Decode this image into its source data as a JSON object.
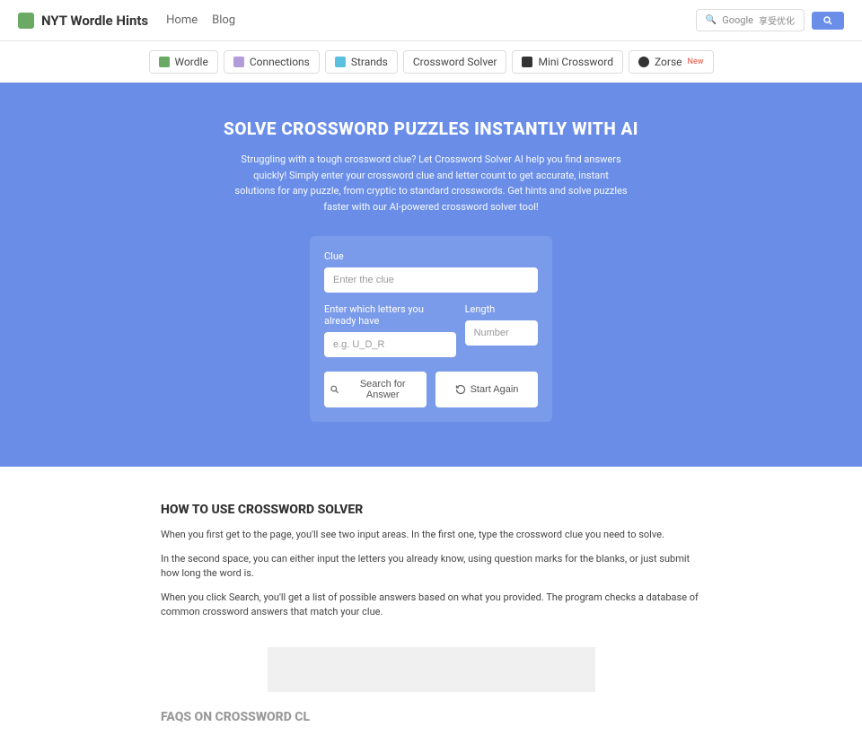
{
  "header": {
    "logo_text": "NYT Wordle Hints",
    "nav": {
      "home": "Home",
      "blog": "Blog"
    },
    "google_label": "Google",
    "google_sub": "享受优化"
  },
  "tabs": [
    {
      "label": "Wordle",
      "icon_color": "#6aaa64"
    },
    {
      "label": "Connections",
      "icon_color": "#b19cd9"
    },
    {
      "label": "Strands",
      "icon_color": "#5bc0de"
    },
    {
      "label": "Crossword Solver",
      "icon_color": ""
    },
    {
      "label": "Mini Crossword",
      "icon_color": "#333"
    },
    {
      "label": "Zorse",
      "icon_color": "#333",
      "new": "New"
    }
  ],
  "hero": {
    "title": "SOLVE CROSSWORD PUZZLES INSTANTLY WITH AI",
    "description": "Struggling with a tough crossword clue? Let Crossword Solver AI help you find answers quickly! Simply enter your crossword clue and letter count to get accurate, instant solutions for any puzzle, from cryptic to standard crosswords. Get hints and solve puzzles faster with our AI-powered crossword solver tool!"
  },
  "form": {
    "clue_label": "Clue",
    "clue_placeholder": "Enter the clue",
    "letters_label": "Enter which letters you already have",
    "letters_placeholder": "e.g. U_D_R",
    "length_label": "Length",
    "length_placeholder": "Number",
    "search_btn": "Search for Answer",
    "reset_btn": "Start Again"
  },
  "howto": {
    "title": "HOW TO USE CROSSWORD SOLVER",
    "p1": "When you first get to the page, you'll see two input areas. In the first one, type the crossword clue you need to solve.",
    "p2": "In the second space, you can either input the letters you already know, using question marks for the blanks, or just submit how long the word is.",
    "p3": "When you click Search, you'll get a list of possible answers based on what you provided. The program checks a database of common crossword answers that match your clue."
  },
  "faq": {
    "title": "FAQS ON CROSSWORD CL"
  }
}
